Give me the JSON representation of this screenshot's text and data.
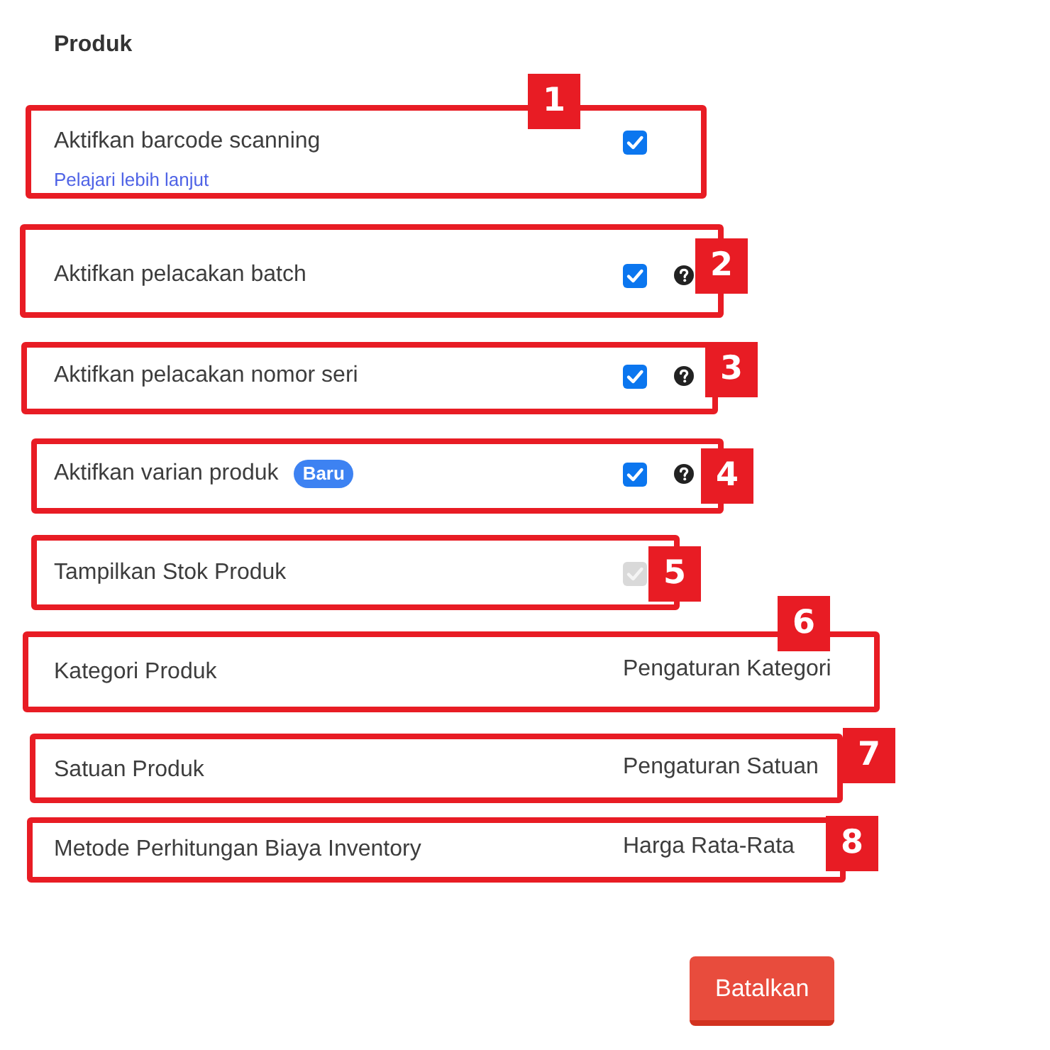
{
  "section": {
    "title": "Produk"
  },
  "settings": [
    {
      "kind": "checkbox",
      "label": "Aktifkan barcode scanning",
      "link": "Pelajari lebih lanjut",
      "checked": true,
      "disabled": false,
      "annotation": "1"
    },
    {
      "kind": "checkbox",
      "label": "Aktifkan pelacakan batch",
      "checked": true,
      "disabled": false,
      "help": true,
      "annotation": "2"
    },
    {
      "kind": "checkbox",
      "label": "Aktifkan pelacakan nomor seri",
      "checked": true,
      "disabled": false,
      "help": true,
      "annotation": "3"
    },
    {
      "kind": "checkbox",
      "label": "Aktifkan varian produk",
      "badge": "Baru",
      "checked": true,
      "disabled": false,
      "help": true,
      "annotation": "4"
    },
    {
      "kind": "checkbox",
      "label": "Tampilkan Stok Produk",
      "checked": true,
      "disabled": true,
      "annotation": "5"
    },
    {
      "kind": "link",
      "label": "Kategori Produk",
      "value": "Pengaturan Kategori",
      "annotation": "6"
    },
    {
      "kind": "link",
      "label": "Satuan Produk",
      "value": "Pengaturan Satuan",
      "annotation": "7"
    },
    {
      "kind": "value",
      "label": "Metode Perhitungan Biaya Inventory",
      "value": "Harga Rata-Rata",
      "annotation": "8"
    }
  ],
  "button": {
    "label": "Batalkan"
  }
}
